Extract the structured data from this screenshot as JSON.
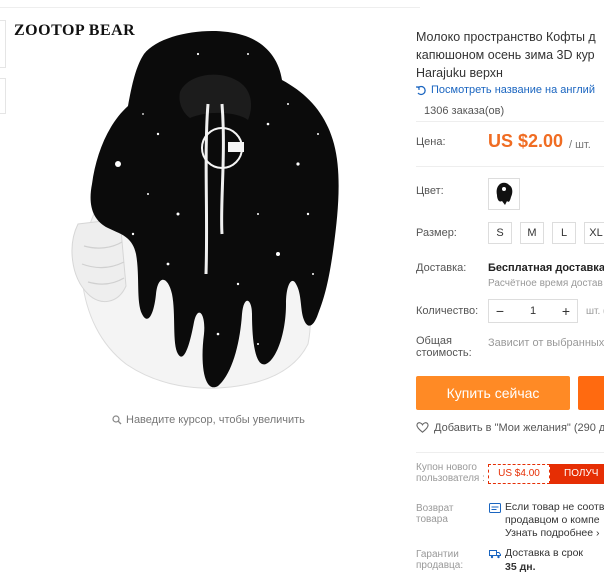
{
  "gallery": {
    "brand": "ZOOTOP BEAR",
    "zoom_hint": "Наведите курсор, чтобы увеличить"
  },
  "product": {
    "title_lines": [
      "Молоко пространство Кофты д",
      "капюшоном осень зима 3D кур",
      "Harajuku верхн"
    ],
    "view_name": "Посмотреть название на англий",
    "orders": "1306 заказа(ов)",
    "price_label": "Цена:",
    "price": "US $2.00",
    "price_unit": "/ шт.",
    "color_label": "Цвет:",
    "size_label": "Размер:",
    "sizes": [
      "S",
      "M",
      "L",
      "XL"
    ],
    "shipping_label": "Доставка:",
    "shipping_value": "Бесплатная доставка г",
    "shipping_time": "Расчётное время достав",
    "qty_label": "Количество:",
    "qty_minus": "−",
    "qty_value": "1",
    "qty_plus": "+",
    "qty_unit": "шт. (",
    "total_label": "Общая стоимость:",
    "total_value": "Зависит от выбранных",
    "buy_now": "Купить сейчас",
    "wishlist": "Добавить в \"Мои желания\" (290 д",
    "coupon_label": "Купон нового пользователя :",
    "coupon_amount": "US $4.00",
    "coupon_get": "ПОЛУЧ",
    "return_label": "Возврат товара",
    "return_lines": [
      "Если товар не соотв",
      "продавцом о компе",
      "Узнать подробнее ›"
    ],
    "guarantee_label": "Гарантии продавца:",
    "guarantee_lines": [
      "Доставка в срок",
      "35 дн."
    ]
  },
  "colors": {
    "price": "#f06c22",
    "buy_button": "#ff8a25",
    "cart_button": "#ff6a10",
    "link": "#1a65c0",
    "coupon": "#e62e04"
  }
}
